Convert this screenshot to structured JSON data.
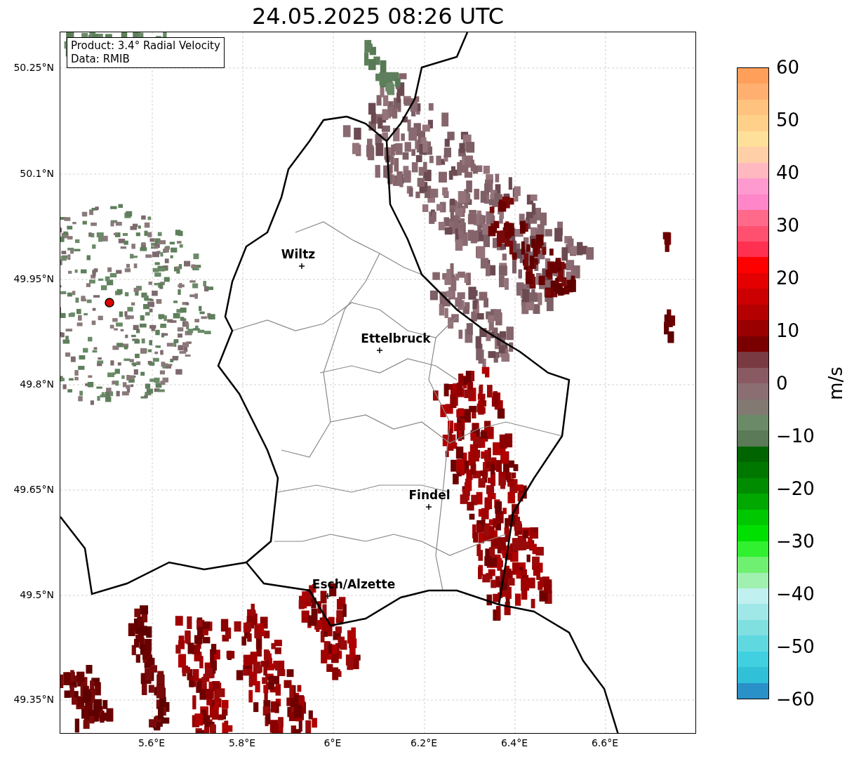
{
  "title": "24.05.2025 08:26 UTC",
  "info_box": {
    "lines": [
      "Product: 3.4° Radial Velocity",
      "Data: RMIB"
    ]
  },
  "map": {
    "cities": [
      {
        "name": "Wiltz"
      },
      {
        "name": "Ettelbruck"
      },
      {
        "name": "Findel"
      },
      {
        "name": "Esch/Alzette"
      }
    ],
    "lat_ticks": [
      "50.25°N",
      "50.1°N",
      "49.95°N",
      "49.8°N",
      "49.65°N",
      "49.5°N",
      "49.35°N"
    ],
    "lon_ticks": [
      "5.6°E",
      "5.8°E",
      "6°E",
      "6.2°E",
      "6.4°E",
      "6.6°E"
    ]
  },
  "colorbar": {
    "label": "m/s",
    "ticks": [
      "60",
      "50",
      "40",
      "30",
      "20",
      "10",
      "0",
      "−10",
      "−20",
      "−30",
      "−40",
      "−50",
      "−60"
    ]
  }
}
